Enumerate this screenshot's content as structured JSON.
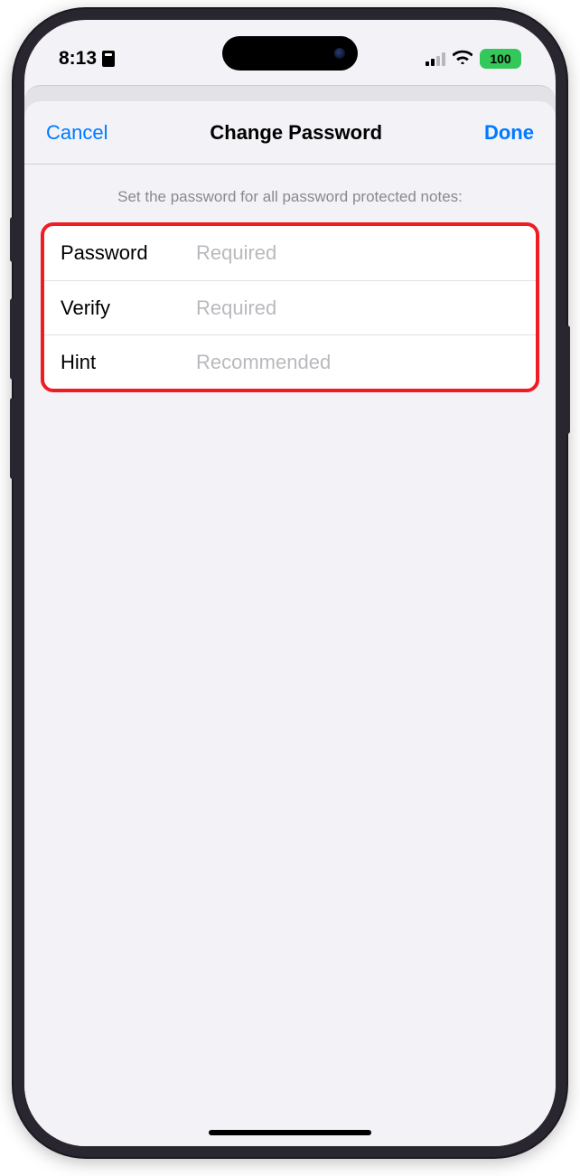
{
  "status": {
    "time": "8:13",
    "battery": "100"
  },
  "nav": {
    "cancel": "Cancel",
    "title": "Change Password",
    "done": "Done"
  },
  "section": {
    "description": "Set the password for all password protected notes:"
  },
  "form": {
    "rows": [
      {
        "label": "Password",
        "placeholder": "Required"
      },
      {
        "label": "Verify",
        "placeholder": "Required"
      },
      {
        "label": "Hint",
        "placeholder": "Recommended"
      }
    ]
  }
}
